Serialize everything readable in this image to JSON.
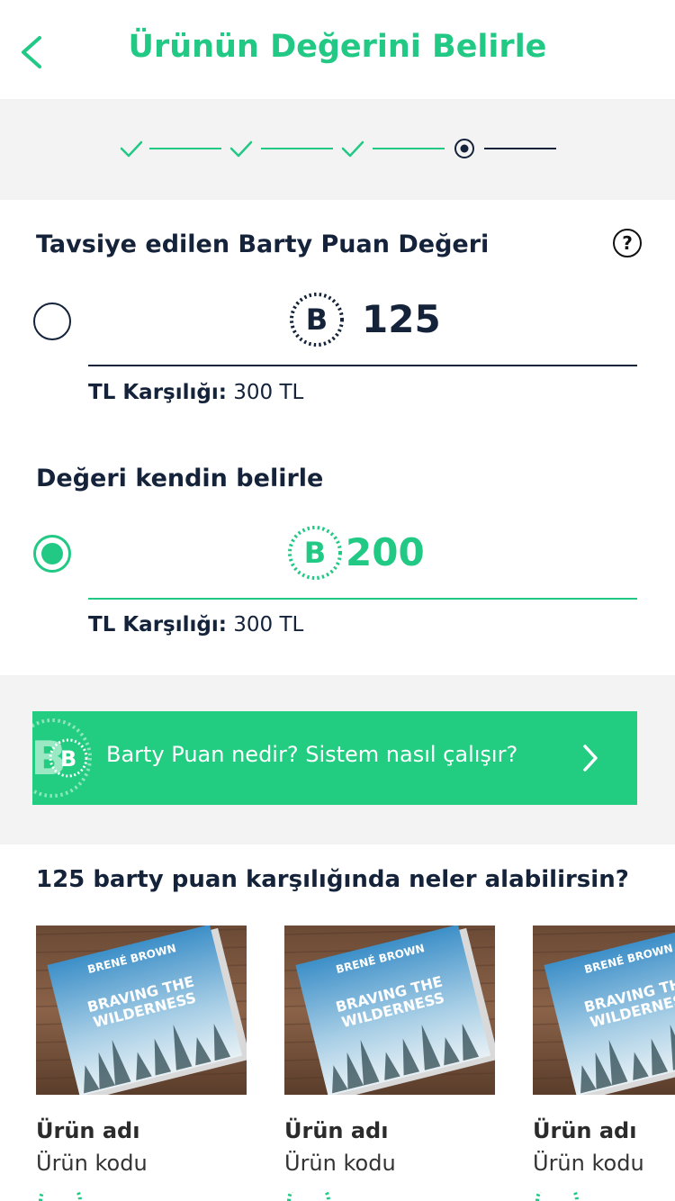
{
  "header": {
    "title": "Ürünün Değerini Belirle"
  },
  "stepper": {
    "steps": [
      "completed",
      "completed",
      "completed",
      "current"
    ]
  },
  "recommended": {
    "label": "Tavsiye edilen Barty Puan Değeri",
    "coin_letter": "B",
    "value": "125",
    "tl_label": "TL Karşılığı:",
    "tl_value": "300 TL",
    "selected": false
  },
  "custom": {
    "label": "Değeri kendin belirle",
    "coin_letter": "B",
    "value": "200",
    "tl_label": "TL Karşılığı:",
    "tl_value": "300 TL",
    "selected": true
  },
  "info_banner": {
    "text": "Barty Puan nedir? Sistem nasıl çalışır?",
    "coin_letter": "B"
  },
  "products": {
    "title": "125 barty puan karşılığında neler alabilirsin?",
    "items": [
      {
        "name": "Ürün adı",
        "code": "Ürün kodu",
        "book_author": "BRENÉ BROWN",
        "book_title_1": "BRAVING THE",
        "book_title_2": "WILDERNESS"
      },
      {
        "name": "Ürün adı",
        "code": "Ürün kodu",
        "book_author": "BRENÉ BROWN",
        "book_title_1": "BRAVING THE",
        "book_title_2": "WILDERNESS"
      },
      {
        "name": "Ürün adı",
        "code": "Ürün kodu",
        "book_author": "BRENÉ BROWN",
        "book_title_1": "BRAVING THE",
        "book_title_2": "WILDERNESS"
      }
    ]
  },
  "colors": {
    "accent": "#22c985",
    "dark": "#14223a",
    "background": "#f3f3f3"
  }
}
